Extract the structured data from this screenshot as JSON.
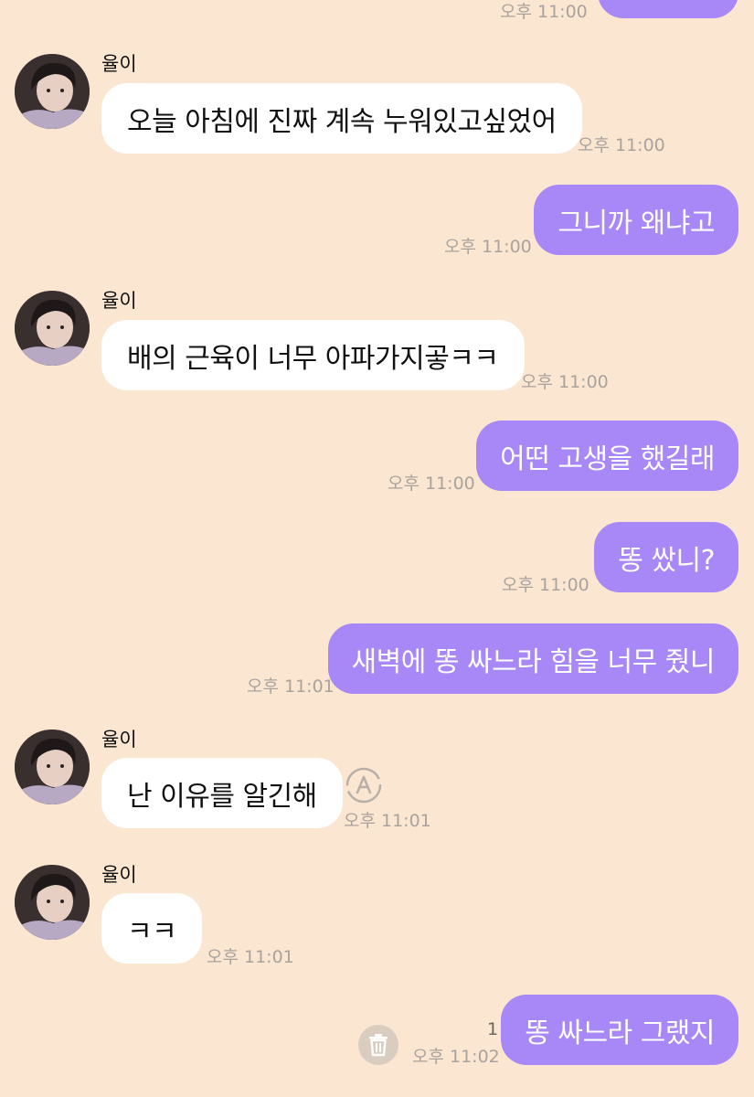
{
  "chat": {
    "partner_name": "율이",
    "messages": [
      {
        "side": "out",
        "text": "",
        "time": "오후 11:00"
      },
      {
        "side": "in",
        "text": "오늘 아침에 진짜 계속 누워있고싶었어",
        "time": "오후 11:00"
      },
      {
        "side": "out",
        "text": "그니까 왜냐고",
        "time": "오후 11:00"
      },
      {
        "side": "in",
        "text": "배의 근육이 너무 아파가지곻ㅋㅋ",
        "time": "오후 11:00"
      },
      {
        "side": "out",
        "text": "어떤 고생을 했길래",
        "time": "오후 11:00"
      },
      {
        "side": "out",
        "text": "똥 쌌니?",
        "time": "오후 11:00"
      },
      {
        "side": "out",
        "text": "새벽에 똥 싸느라 힘을 너무 줬니",
        "time": "오후 11:01"
      },
      {
        "side": "in",
        "text": "난 이유를 알긴해",
        "time": "오후 11:01"
      },
      {
        "side": "in",
        "text": "ㅋㅋ",
        "time": "오후 11:01"
      },
      {
        "side": "out",
        "text": "똥 싸느라 그랬지",
        "time": "오후 11:02",
        "unread": "1"
      }
    ]
  },
  "icons": {
    "translate": "translate-icon",
    "delete": "trash-icon",
    "avatar": "avatar-photo"
  },
  "colors": {
    "background": "#fbe6d1",
    "outgoing_bubble": "#a887f6",
    "incoming_bubble": "#ffffff",
    "timestamp": "#a9a39d"
  }
}
